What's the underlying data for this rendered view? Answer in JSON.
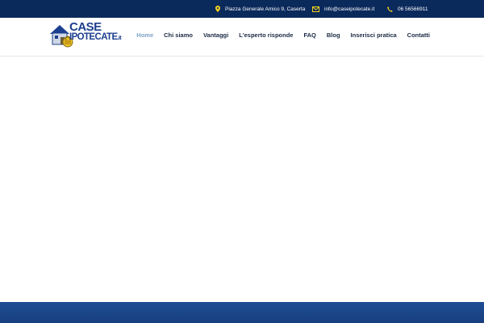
{
  "topbar": {
    "address": "Piazza Generale Amico 9, Caserta",
    "email": "info@caseipotecate.it",
    "phone": "06 56566911",
    "icons": [
      "location-pin-icon",
      "envelope-icon",
      "phone-icon"
    ],
    "icon_color": "#f2d21b",
    "background": "#0b2a5c"
  },
  "logo": {
    "line1": "CASE",
    "line2": "IPOTECATE",
    "tld": ".it"
  },
  "nav": {
    "items": [
      "Home",
      "Chi siamo",
      "Vantaggi",
      "L'esperto risponde",
      "FAQ",
      "Blog",
      "Inserisci pratica",
      "Contatti"
    ],
    "active": "Home",
    "active_color": "#7ea4c8"
  },
  "colors": {
    "brand": "#1d3f8f",
    "footer": "#1e4d94"
  }
}
